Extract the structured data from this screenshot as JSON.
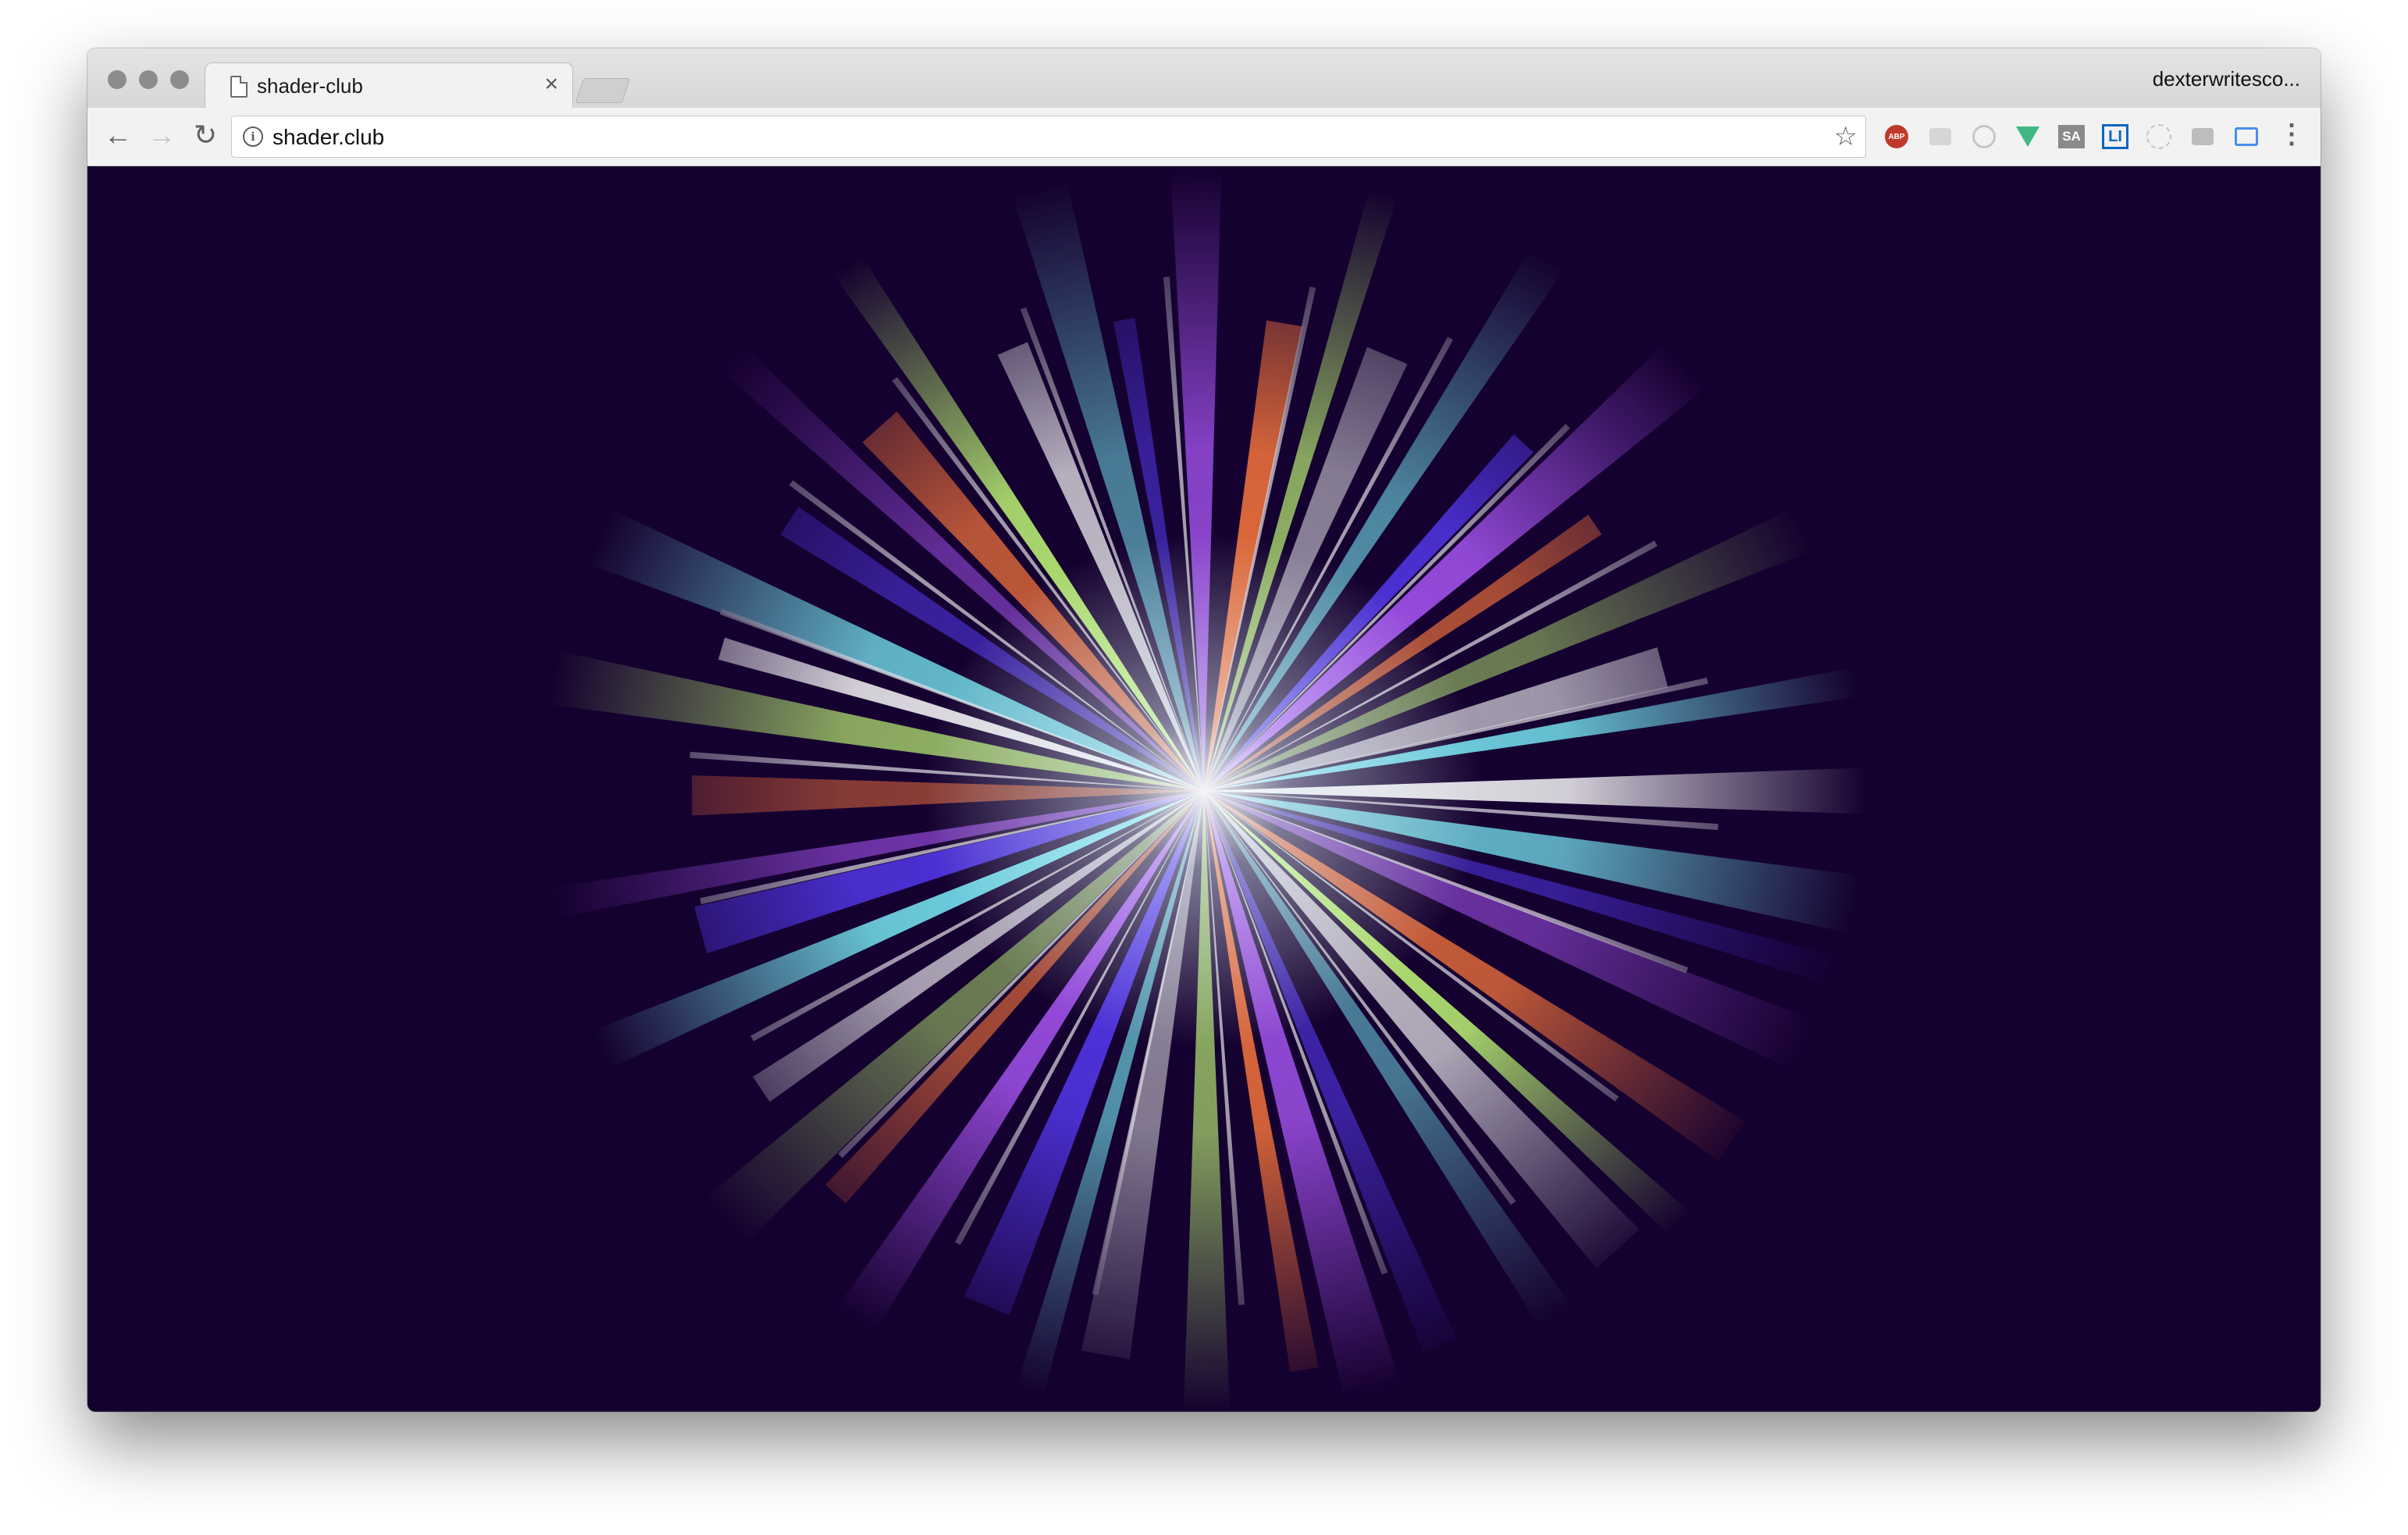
{
  "browser": {
    "tab": {
      "title": "shader-club",
      "close_glyph": "×"
    },
    "profile_name": "dexterwritesco...",
    "toolbar": {
      "back_glyph": "←",
      "forward_glyph": "→",
      "reload_glyph": "↻",
      "info_glyph": "i",
      "url": "shader.club",
      "bookmark_glyph": "☆",
      "menu_glyph": "⋮"
    },
    "extensions": [
      {
        "name": "adblock-plus-icon",
        "label": "ABP"
      },
      {
        "name": "comment-extension-icon",
        "label": ""
      },
      {
        "name": "circle-extension-icon",
        "label": ""
      },
      {
        "name": "vue-devtools-icon",
        "label": ""
      },
      {
        "name": "sa-extension-icon",
        "label": "SA"
      },
      {
        "name": "li-extension-icon",
        "label": "LI"
      },
      {
        "name": "react-devtools-icon",
        "label": ""
      },
      {
        "name": "reader-extension-icon",
        "label": ""
      },
      {
        "name": "cast-icon",
        "label": ""
      }
    ]
  },
  "page": {
    "background_color": "#15012f",
    "visual": "radial starburst shader",
    "palette": [
      "#ffffff",
      "#7df4ff",
      "#5a3dff",
      "#b05aff",
      "#ff7a3d",
      "#c6ff7a"
    ]
  }
}
